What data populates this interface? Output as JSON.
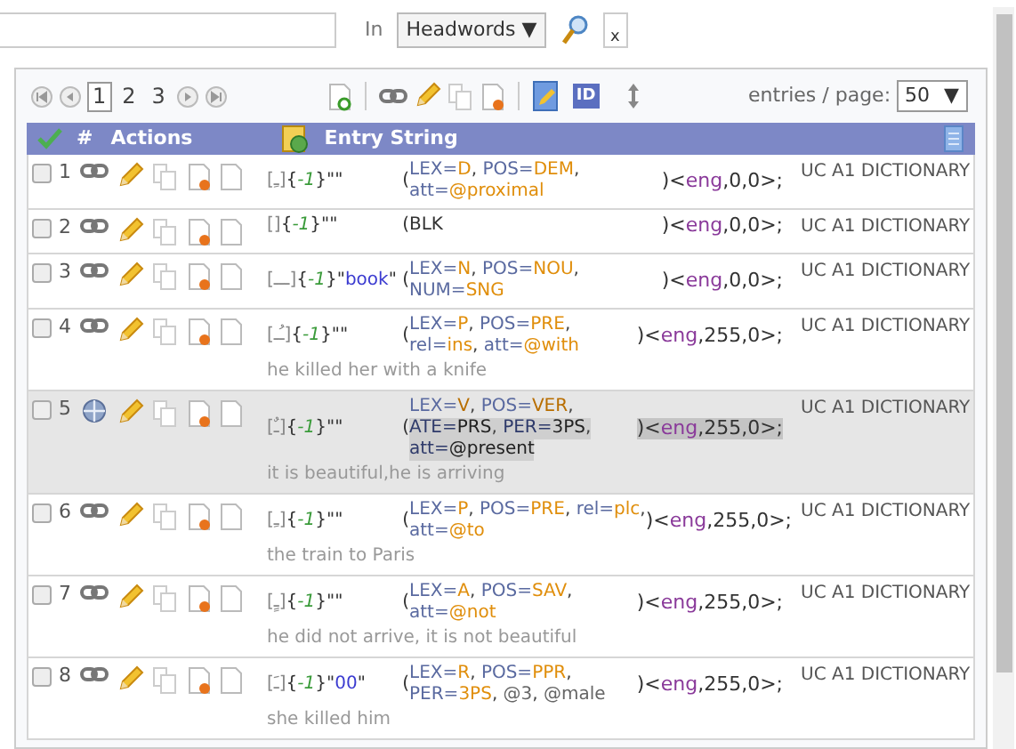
{
  "search": {
    "scope_label": "In",
    "scope": "Headwords",
    "scope_arrow": "▼",
    "clear_label": "x"
  },
  "toolbar": {
    "pages": [
      {
        "label": "1",
        "selected": true
      },
      {
        "label": "2",
        "selected": false
      },
      {
        "label": "3",
        "selected": false
      }
    ],
    "id_label": "ID",
    "per_page_label": "entries / page:",
    "per_page": "50",
    "per_page_arrow": "▼"
  },
  "table": {
    "columns": [
      "#",
      "Actions",
      "Entry String"
    ],
    "rows": [
      {
        "number": "1",
        "selected": false,
        "headword": "[ـِ]",
        "prefix": "{-1}",
        "word": "\"\"",
        "open": "(",
        "attributes": [
          "LEX=D, POS=DEM,",
          "att=@proximal"
        ],
        "closing": ")<eng,0,0>;",
        "dictionary": "UC A1 DICTIONARY"
      },
      {
        "number": "2",
        "selected": false,
        "headword": "[]",
        "prefix": "{-1}",
        "word": "\"\"",
        "open": "(",
        "attributes": [
          "BLK"
        ],
        "closing": ")<eng,0,0>;",
        "dictionary": "UC A1 DICTIONARY"
      },
      {
        "number": "3",
        "selected": false,
        "headword": "[ـــ]",
        "prefix": "{-1}",
        "word": "\"book\"",
        "open": "(",
        "attributes": [
          "LEX=N, POS=NOU,",
          "NUM=SNG"
        ],
        "closing": ")<eng,0,0>;",
        "dictionary": "UC A1 DICTIONARY"
      },
      {
        "number": "4",
        "selected": false,
        "headword": "[ـُـ]",
        "prefix": "{-1}",
        "word": "\"\"",
        "open": "(",
        "attributes": [
          "LEX=P, POS=PRE,",
          "rel=ins, att=@with"
        ],
        "closing": ")<eng,255,0>;",
        "example": "he killed her with a knife",
        "dictionary": "UC A1 DICTIONARY"
      },
      {
        "number": "5",
        "selected": true,
        "headword": "[ـٌ]",
        "prefix": "{-1}",
        "word": "\"\"",
        "open": "(",
        "attributes": [
          "LEX=V, POS=VER,",
          "ATE=PRS, PER=3PS,",
          "att=@present"
        ],
        "closing": ")<eng,255,0>;",
        "example": "it is beautiful,he is arriving",
        "dictionary": "UC A1 DICTIONARY"
      },
      {
        "number": "6",
        "selected": false,
        "headword": "[ـِ]",
        "prefix": "{-1}",
        "word": "\"\"",
        "open": "(",
        "attributes": [
          "LEX=P, POS=PRE, rel=plc,",
          "att=@to"
        ],
        "closing": ")<eng,255,0>;",
        "example": "the train to Paris",
        "dictionary": "UC A1 DICTIONARY"
      },
      {
        "number": "7",
        "selected": false,
        "headword": "[ـٍ]",
        "prefix": "{-1}",
        "word": "\"\"",
        "open": "(",
        "attributes": [
          "LEX=A, POS=SAV,",
          "att=@not"
        ],
        "closing": ")<eng,255,0>;",
        "example": "he did not arrive, it is not beautiful",
        "dictionary": "UC A1 DICTIONARY"
      },
      {
        "number": "8",
        "selected": false,
        "headword": "[ـَ]",
        "prefix": "{-1}",
        "word": "\"00\"",
        "open": "(",
        "attributes": [
          "LEX=R, POS=PPR,",
          "PER=3PS, @3, @male"
        ],
        "closing": ")<eng,255,0>;",
        "example": "she killed him",
        "dictionary": "UC A1 DICTIONARY"
      }
    ]
  }
}
